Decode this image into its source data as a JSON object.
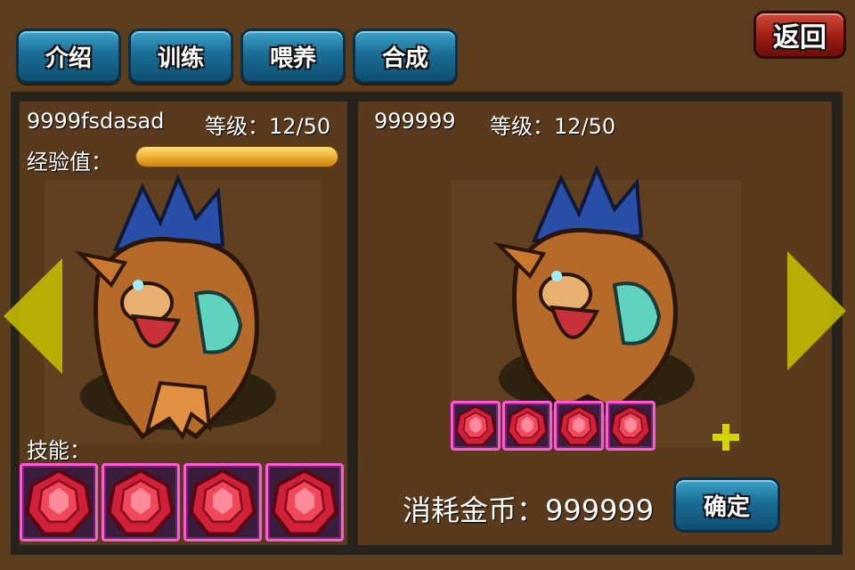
{
  "tabs": [
    {
      "label": "介绍"
    },
    {
      "label": "训练"
    },
    {
      "label": "喂养"
    },
    {
      "label": "合成"
    }
  ],
  "back_button": {
    "label": "返回"
  },
  "left_panel": {
    "pet_name": "9999fsdasad",
    "level_label": "等级：12/50",
    "exp_label": "经验值：",
    "exp_fraction": 1.0,
    "skills_label": "技能：",
    "skill_gems": [
      "ruby-gem-icon",
      "ruby-gem-icon",
      "ruby-gem-icon",
      "ruby-gem-icon"
    ]
  },
  "right_panel": {
    "pet_name": "999999",
    "level_label": "等级：12/50",
    "material_gems": [
      "ruby-gem-icon",
      "ruby-gem-icon",
      "ruby-gem-icon",
      "ruby-gem-icon"
    ],
    "cost_label": "消耗金币：999999",
    "confirm_label": "确定"
  },
  "colors": {
    "background": "#5b3d1d",
    "frame": "#26231c",
    "tab": "#1a6d96",
    "back_button": "#9d1d14",
    "arrow": "#c8c200",
    "plus": "#d4d400",
    "gem": "#d0203a",
    "gem_border": "#ff5ad6"
  }
}
